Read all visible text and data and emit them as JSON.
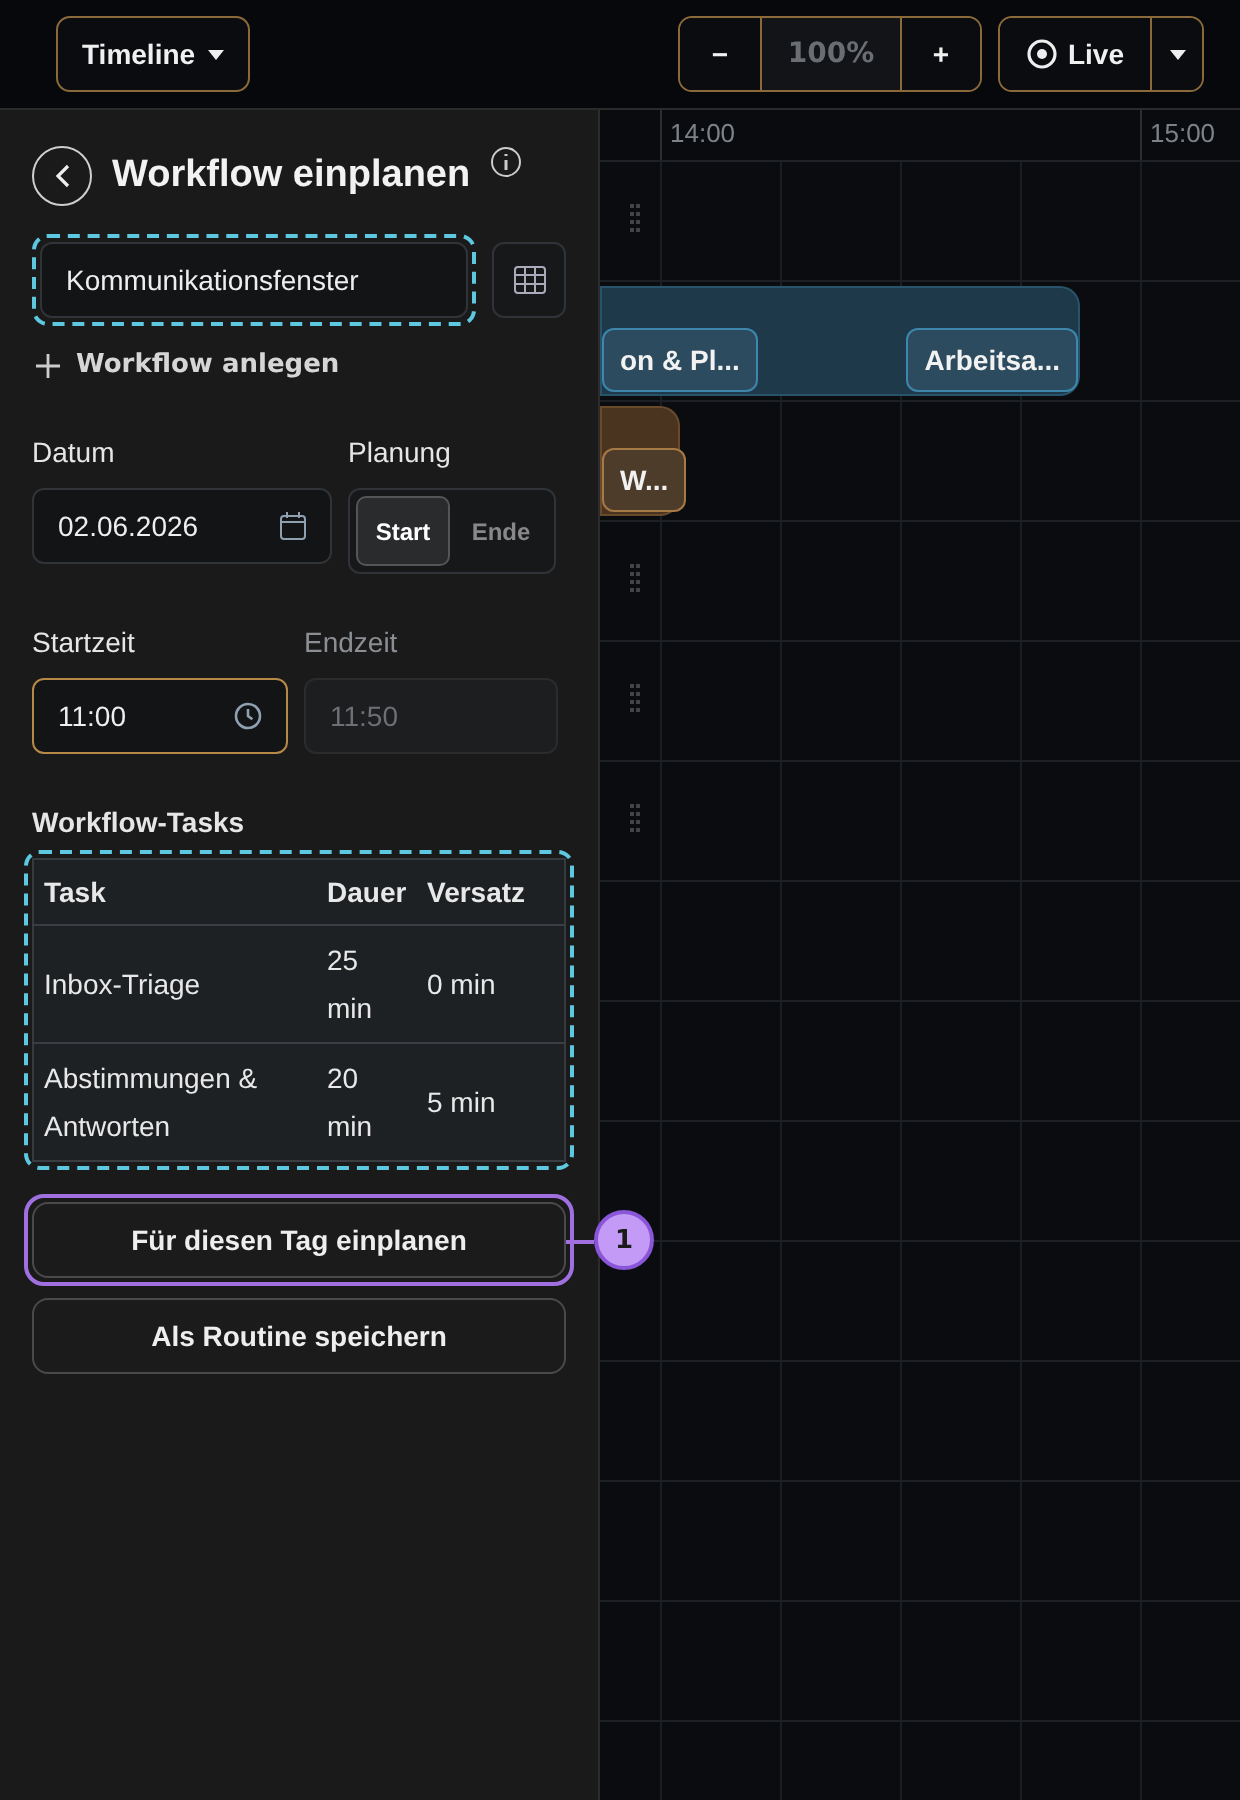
{
  "toolbar": {
    "view_menu": "Timeline",
    "zoom": {
      "minus": "−",
      "value": "100%",
      "plus": "+"
    },
    "live": "Live"
  },
  "timeline": {
    "hours": [
      "14:00",
      "15:00"
    ],
    "bands": [
      {
        "color": "#1e3a4a",
        "chips": [
          {
            "label": "on & Pl..."
          },
          {
            "label": "Arbeitsa..."
          }
        ]
      },
      {
        "color": "#4a3420",
        "chips": [
          {
            "label": "W..."
          }
        ]
      }
    ]
  },
  "panel": {
    "title": "Workflow einplanen",
    "workflow_select": {
      "value": "Kommunikationsfenster",
      "highlighted": true
    },
    "add_link": "Workflow anlegen",
    "datum": {
      "label": "Datum",
      "value": "02.06.2026"
    },
    "planung": {
      "label": "Planung",
      "options": [
        {
          "label": "Start",
          "selected": true
        },
        {
          "label": "Ende",
          "selected": false
        }
      ]
    },
    "startzeit": {
      "label": "Startzeit",
      "value": "11:00",
      "focused": true
    },
    "endzeit": {
      "label": "Endzeit",
      "value": "11:50",
      "disabled": true
    },
    "tasks": {
      "label": "Workflow-Tasks",
      "highlighted": true,
      "columns": [
        "Task",
        "Dauer",
        "Versatz"
      ],
      "rows": [
        [
          "Inbox-Triage",
          "25 min",
          "0 min"
        ],
        [
          "Abstimmungen & Antworten",
          "20 min",
          "5 min"
        ]
      ]
    },
    "buttons": [
      {
        "label": "Für diesen Tag einplanen",
        "highlighted": true,
        "callout": "1"
      },
      {
        "label": "Als Routine speichern",
        "highlighted": false
      }
    ]
  }
}
